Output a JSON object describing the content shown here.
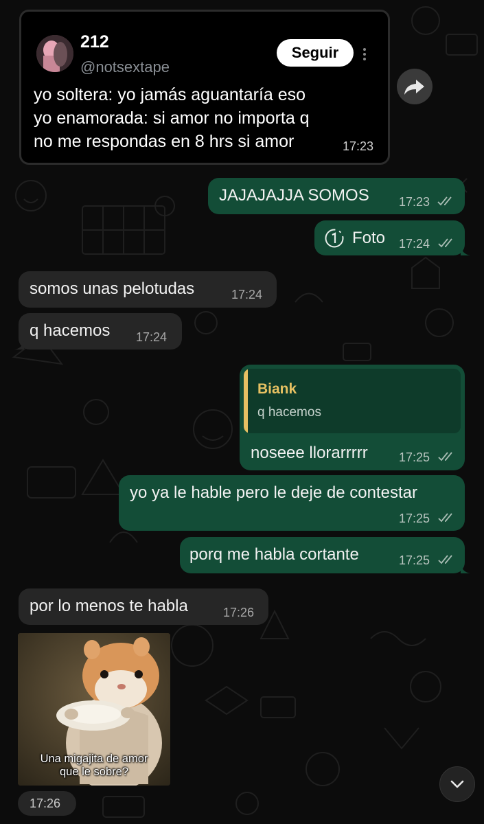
{
  "tweet": {
    "name": "212",
    "handle": "@notsextape",
    "follow_label": "Seguir",
    "body": "yo soltera: yo jamás aguantaría eso\nyo enamorada: si amor no importa q\nno me respondas en 8 hrs si amor",
    "time": "17:23"
  },
  "messages": [
    {
      "text": "JAJAJAJJA SOMOS",
      "time": "17:23",
      "direction": "out"
    },
    {
      "text": "Foto",
      "time": "17:24",
      "direction": "out"
    },
    {
      "text": "somos unas pelotudas",
      "time": "17:24",
      "direction": "in"
    },
    {
      "text": "q hacemos",
      "time": "17:24",
      "direction": "in"
    },
    {
      "text": "noseee llorarrrrr",
      "time": "17:25",
      "direction": "out"
    },
    {
      "text": "yo ya le hable pero le deje de contestar",
      "time": "17:25",
      "direction": "out"
    },
    {
      "text": "porq me habla cortante",
      "time": "17:25",
      "direction": "out"
    },
    {
      "text": "por lo menos te habla",
      "time": "17:26",
      "direction": "in"
    }
  ],
  "reply": {
    "author": "Biank",
    "text": "q hacemos"
  },
  "image_message": {
    "caption": "Una migajita de amor\nque le sobre?",
    "time": "17:26"
  },
  "colors": {
    "outgoing_bubble": "#134d37",
    "incoming_bubble": "#262626",
    "reply_author": "#e7c162",
    "background": "#0c0c0c"
  },
  "icons": [
    "forward-icon",
    "view-once-icon",
    "double-check-icon",
    "chevron-down-icon",
    "more-vertical-icon"
  ]
}
